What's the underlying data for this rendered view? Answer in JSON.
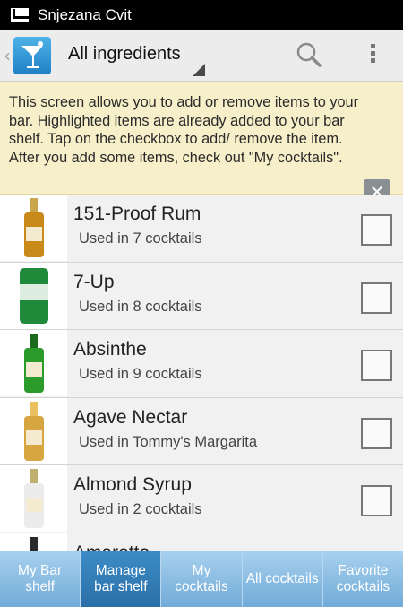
{
  "status_bar": {
    "account_name": "Snjezana Cvit"
  },
  "action_bar": {
    "spinner_label": "All ingredients"
  },
  "info_banner": {
    "text": "This screen allows you to add or remove items to your bar. Highlighted items are already added to your bar shelf. Tap on the checkbox to add/ remove the item. After you add some items, check out \"My cocktails\"."
  },
  "ingredients": [
    {
      "name": "151-Proof Rum",
      "usage": "Used in 7 cocktails",
      "checked": false,
      "color": "#c98a1a",
      "cap": "#c9a64a"
    },
    {
      "name": "7-Up",
      "usage": "Used in 8 cocktails",
      "checked": false,
      "color": "#1e8a3a",
      "cap": "#1e8a3a"
    },
    {
      "name": "Absinthe",
      "usage": "Used in 9 cocktails",
      "checked": false,
      "color": "#2b9b2b",
      "cap": "#1c6b1c"
    },
    {
      "name": "Agave Nectar",
      "usage": "Used in Tommy's Margarita",
      "checked": false,
      "color": "#d7a640",
      "cap": "#e8c060"
    },
    {
      "name": "Almond Syrup",
      "usage": "Used in 2 cocktails",
      "checked": false,
      "color": "#ececec",
      "cap": "#c0b070"
    },
    {
      "name": "Amaretto",
      "usage": "",
      "checked": false,
      "color": "#6b3a10",
      "cap": "#2a2a2a"
    }
  ],
  "tabs": [
    {
      "label": "My Bar shelf",
      "active": false
    },
    {
      "label": "Manage bar shelf",
      "active": true
    },
    {
      "label": "My cocktails",
      "active": false
    },
    {
      "label": "All cocktails",
      "active": false
    },
    {
      "label": "Favorite cocktails",
      "active": false
    }
  ],
  "colors": {
    "accent": "#33b5e5",
    "tab_active": "#2b6fa8",
    "banner": "#f7efc9"
  }
}
